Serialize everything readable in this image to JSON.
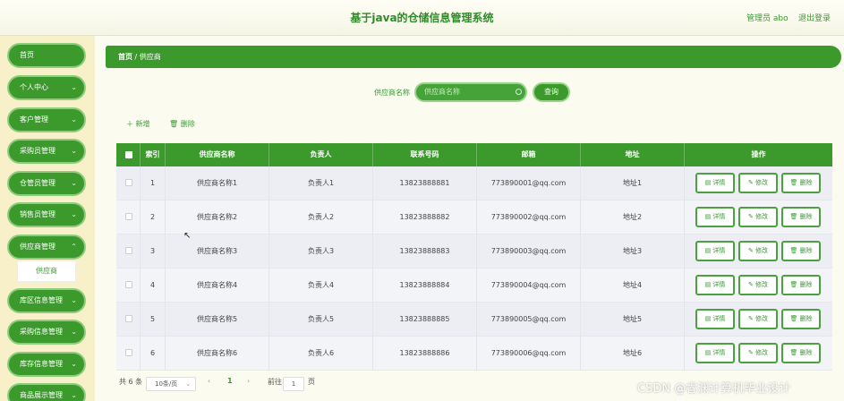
{
  "header": {
    "title": "基于java的仓储信息管理系统",
    "admin": "管理员 abo",
    "logout": "退出登录"
  },
  "sidebar": {
    "items": [
      {
        "label": "首页",
        "chevron": false
      },
      {
        "label": "个人中心",
        "chevron": true
      },
      {
        "label": "客户管理",
        "chevron": true
      },
      {
        "label": "采购员管理",
        "chevron": true
      },
      {
        "label": "仓管员管理",
        "chevron": true
      },
      {
        "label": "销售员管理",
        "chevron": true
      },
      {
        "label": "供应商管理",
        "chevron": true
      },
      {
        "label": "库区信息管理",
        "chevron": true
      },
      {
        "label": "采购信息管理",
        "chevron": true
      },
      {
        "label": "库存信息管理",
        "chevron": true
      },
      {
        "label": "商品展示管理",
        "chevron": true
      }
    ],
    "active_sub": "供应商"
  },
  "breadcrumb": {
    "home": "首页",
    "sep": "/",
    "current": "供应商"
  },
  "search": {
    "label": "供应商名称",
    "placeholder": "供应商名称",
    "button": "查询"
  },
  "toolbar": {
    "add": "＋ 新增",
    "delete": "🗑 删除"
  },
  "table": {
    "headers": [
      "索引",
      "供应商名称",
      "负责人",
      "联系号码",
      "邮箱",
      "地址",
      "操作"
    ],
    "rows": [
      {
        "index": "1",
        "name": "供应商名称1",
        "owner": "负责人1",
        "phone": "13823888881",
        "email": "773890001@qq.com",
        "address": "地址1"
      },
      {
        "index": "2",
        "name": "供应商名称2",
        "owner": "负责人2",
        "phone": "13823888882",
        "email": "773890002@qq.com",
        "address": "地址2"
      },
      {
        "index": "3",
        "name": "供应商名称3",
        "owner": "负责人3",
        "phone": "13823888883",
        "email": "773890003@qq.com",
        "address": "地址3"
      },
      {
        "index": "4",
        "name": "供应商名称4",
        "owner": "负责人4",
        "phone": "13823888884",
        "email": "773890004@qq.com",
        "address": "地址4"
      },
      {
        "index": "5",
        "name": "供应商名称5",
        "owner": "负责人5",
        "phone": "13823888885",
        "email": "773890005@qq.com",
        "address": "地址5"
      },
      {
        "index": "6",
        "name": "供应商名称6",
        "owner": "负责人6",
        "phone": "13823888886",
        "email": "773890006@qq.com",
        "address": "地址6"
      }
    ],
    "actions": {
      "detail": "▤ 详情",
      "edit": "✎ 修改",
      "delete": "🗑 删除"
    }
  },
  "pagination": {
    "total": "共 6 条",
    "page_size": "10条/页",
    "prev": "‹",
    "current": "1",
    "next": "›",
    "goto": "前往",
    "goto_value": "1",
    "page_unit": "页"
  },
  "watermark": "CSDN @睿渊计算机毕业设计",
  "colors": {
    "primary": "#3c9a2d",
    "sidebar_bg": "#f8f0c8",
    "title": "#2f8a2a"
  }
}
